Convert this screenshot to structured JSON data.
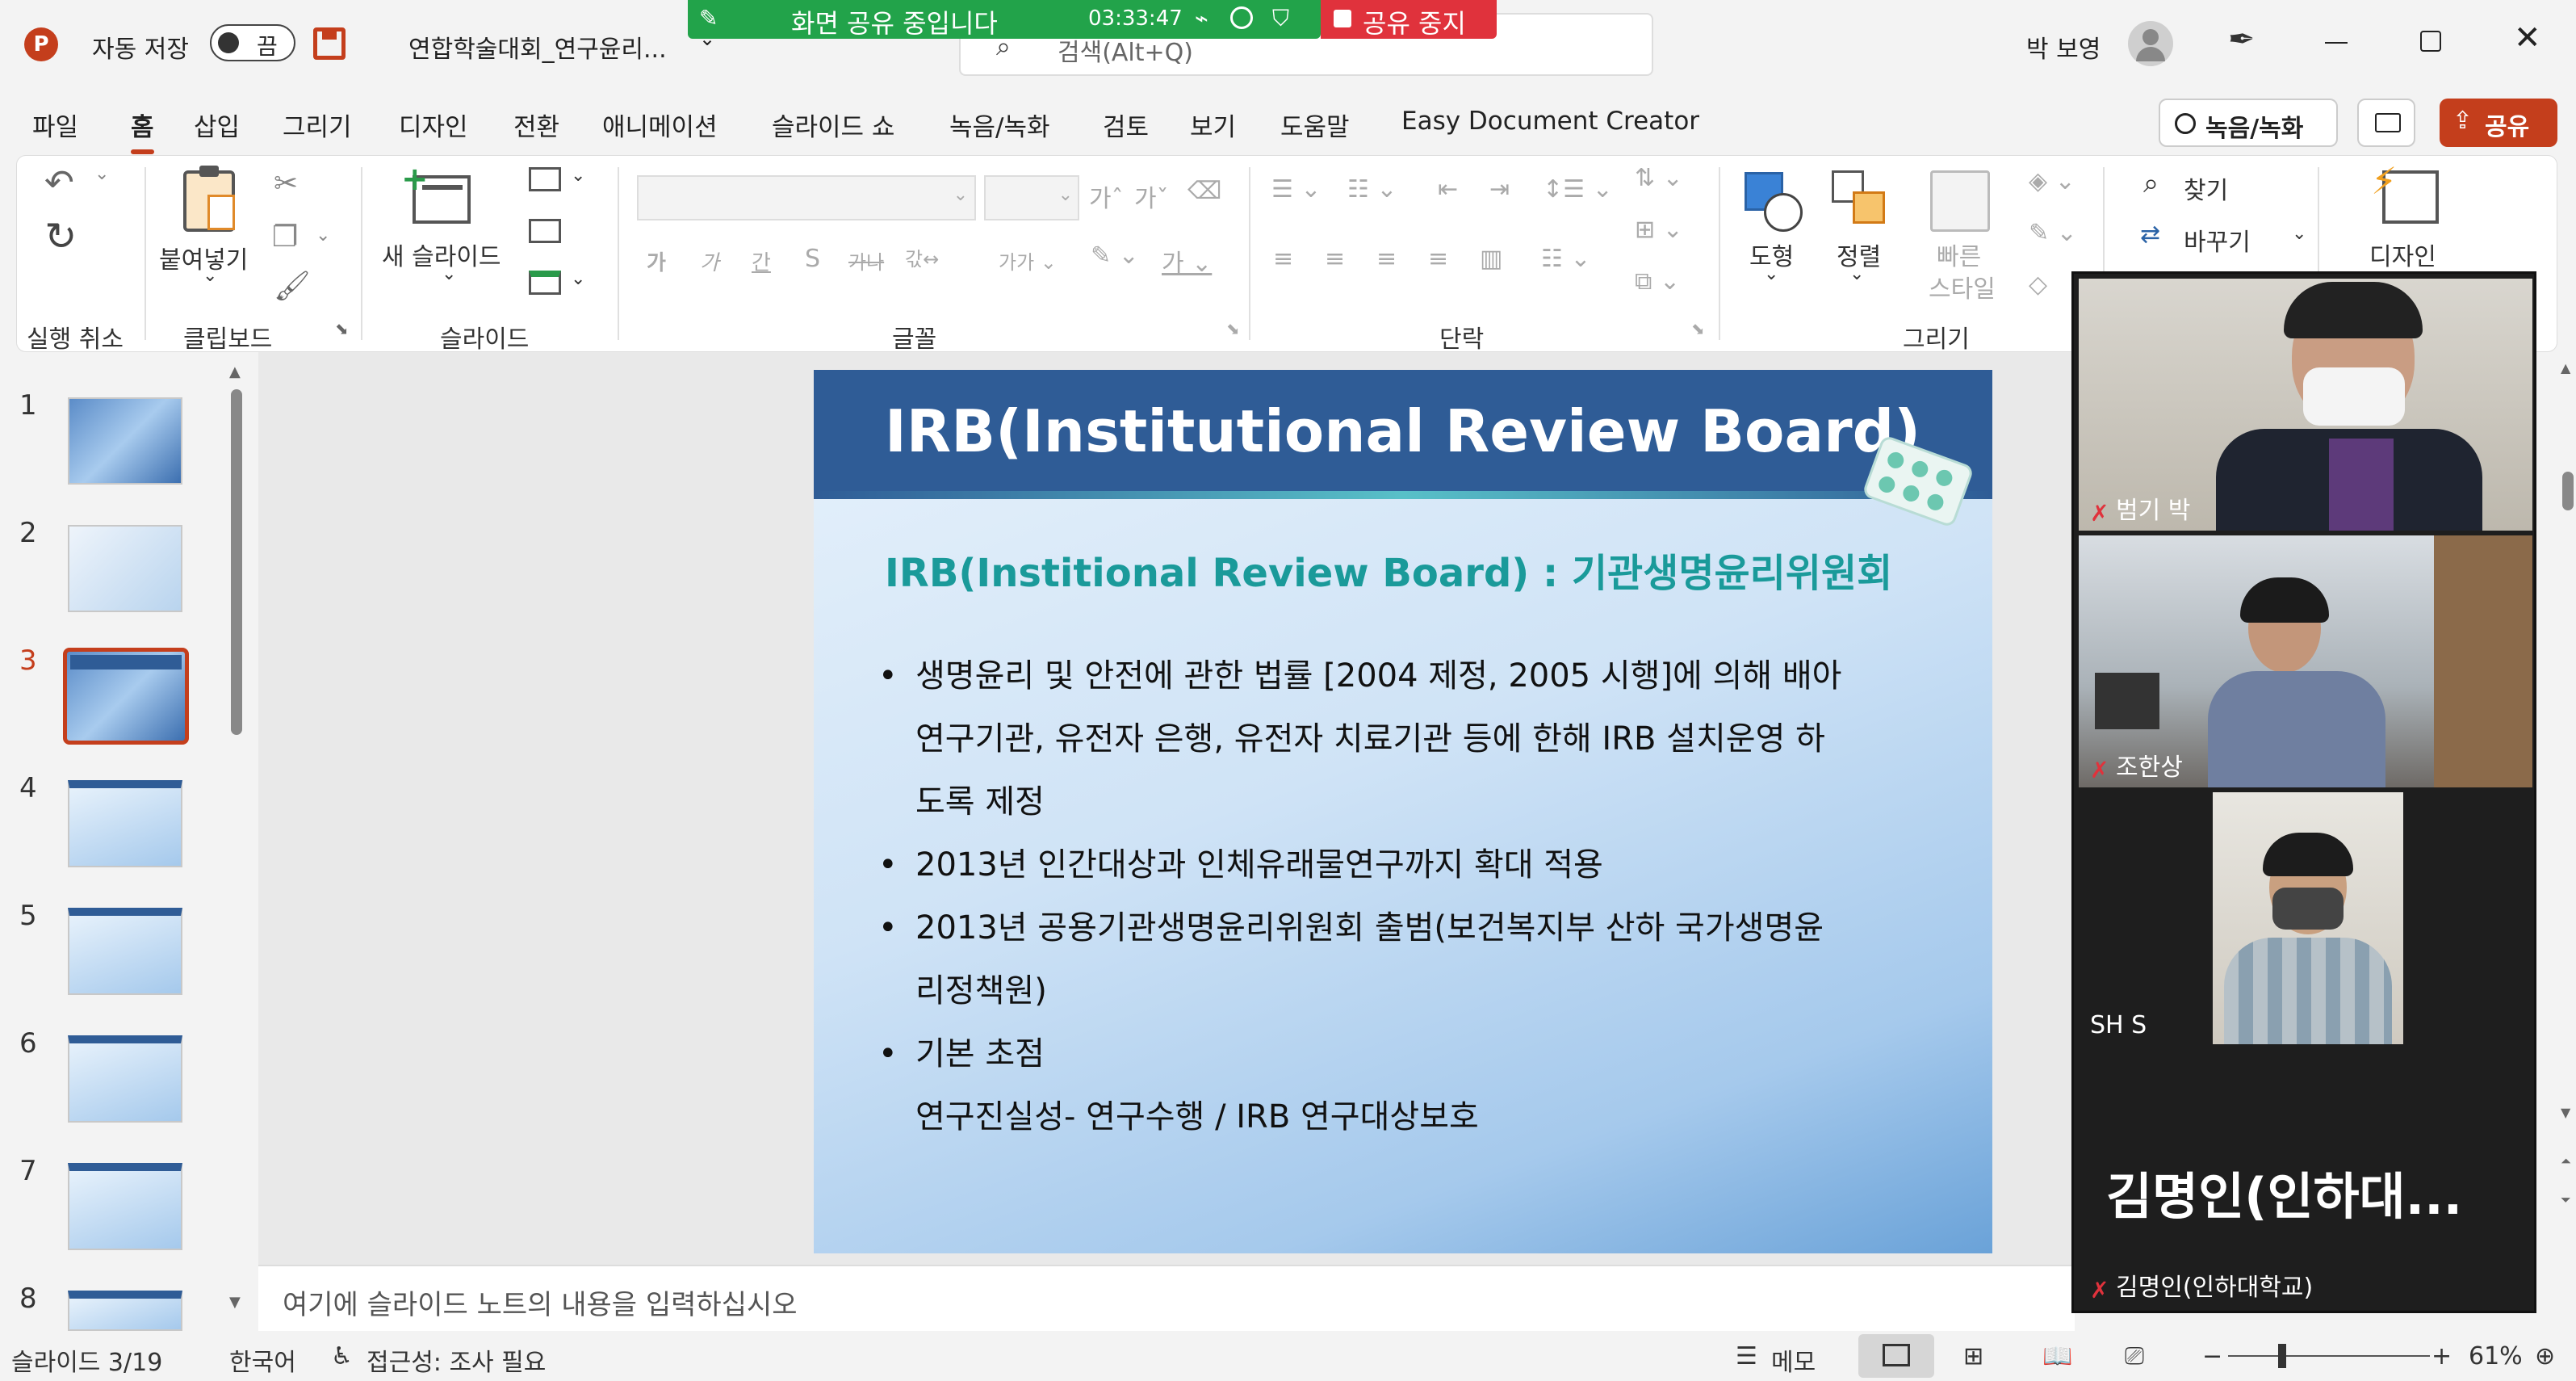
{
  "titlebar": {
    "autosave_label": "자동 저장",
    "autosave_state": "끔",
    "filename": "연합학술대회_연구윤리...",
    "search_placeholder": "검색(Alt+Q)",
    "user_name": "박 보영"
  },
  "share": {
    "status": "화면 공유 중입니다",
    "timer": "03:33:47",
    "stop_label": "공유 중지"
  },
  "menu": {
    "items": [
      "파일",
      "홈",
      "삽입",
      "그리기",
      "디자인",
      "전환",
      "애니메이션",
      "슬라이드 쇼",
      "녹음/녹화",
      "검토",
      "보기",
      "도움말",
      "Easy Document Creator"
    ],
    "active": "홈",
    "record_button": "녹음/녹화",
    "share_button": "공유"
  },
  "ribbon": {
    "groups": {
      "undo": "실행 취소",
      "clipboard": "클립보드",
      "slides": "슬라이드",
      "font": "글꼴",
      "paragraph": "단락",
      "drawing": "그리기"
    },
    "paste_label": "붙여넣기",
    "new_slide_label": "새 슬라이드",
    "shape_label": "도형",
    "arrange_label": "정렬",
    "quick_style_label_1": "빠른",
    "quick_style_label_2": "스타일",
    "find_label": "찾기",
    "replace_label": "바꾸기",
    "design_label": "디자인"
  },
  "thumbnails": {
    "numbers": [
      "1",
      "2",
      "3",
      "4",
      "5",
      "6",
      "7",
      "8"
    ],
    "active": "3"
  },
  "slide": {
    "title": "IRB(Institutional Review Board)",
    "subtitle": "IRB(Institional Review Board) : 기관생명윤리위원회",
    "bullet1_line1": "생명윤리 및 안전에 관한 법률 [2004 제정, 2005 시행]에 의해 배아",
    "bullet1_line2": "연구기관, 유전자 은행, 유전자 치료기관 등에 한해 IRB 설치운영 하",
    "bullet1_line3": "도록 제정",
    "bullet2": "2013년 인간대상과 인체유래물연구까지 확대 적용",
    "bullet3_line1": "2013년 공용기관생명윤리위원회 출범(보건복지부 산하 국가생명윤",
    "bullet3_line2": "리정책원)",
    "bullet4_line1": "기본 초점",
    "bullet4_line2": "연구진실성- 연구수행  / IRB 연구대상보호"
  },
  "notes": {
    "placeholder": "여기에 슬라이드 노트의 내용을 입력하십시오"
  },
  "status": {
    "slide_count": "슬라이드 3/19",
    "language": "한국어",
    "accessibility": "접근성: 조사 필요",
    "notes_button": "메모",
    "zoom": "61%"
  },
  "participants": [
    {
      "name": "범기 박",
      "muted": true
    },
    {
      "name": "조한상",
      "muted": true
    },
    {
      "name": "SH S",
      "muted": false
    },
    {
      "name": "김명인(인하대학교)",
      "display": "김명인(인하대...",
      "muted": true
    }
  ]
}
